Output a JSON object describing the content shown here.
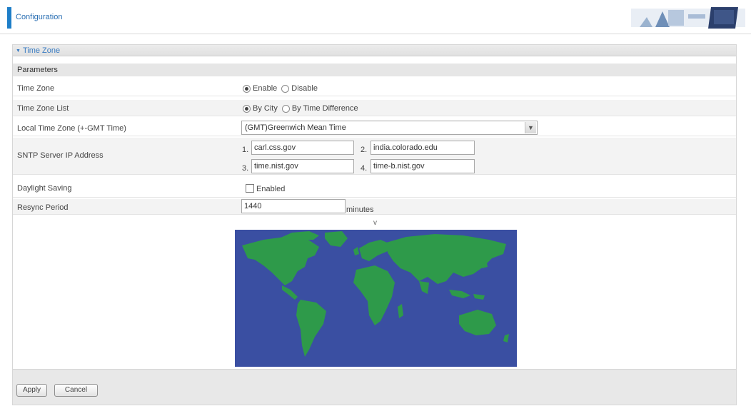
{
  "header": {
    "title": "Configuration"
  },
  "section": {
    "title": "Time Zone"
  },
  "params": {
    "title": "Parameters"
  },
  "time_zone": {
    "label": "Time Zone",
    "options": [
      "Enable",
      "Disable"
    ],
    "selected": "Enable"
  },
  "time_zone_list": {
    "label": "Time Zone List",
    "options": [
      "By City",
      "By Time Difference"
    ],
    "selected": "By City"
  },
  "local_time_zone": {
    "label": "Local Time Zone (+-GMT Time)",
    "value": "(GMT)Greenwich Mean Time"
  },
  "sntp": {
    "label": "SNTP Server IP Address",
    "servers": [
      {
        "num": "1.",
        "value": "carl.css.gov"
      },
      {
        "num": "2.",
        "value": "india.colorado.edu"
      },
      {
        "num": "3.",
        "value": "time.nist.gov"
      },
      {
        "num": "4.",
        "value": "time-b.nist.gov"
      }
    ]
  },
  "daylight": {
    "label": "Daylight Saving",
    "option": "Enabled",
    "checked": false
  },
  "resync": {
    "label": "Resync Period",
    "value": "1440",
    "unit": "minutes"
  },
  "map": {
    "marker": "v",
    "ocean_color": "#3a4fa2",
    "land_color": "#2e9a4a"
  },
  "footer": {
    "apply": "Apply",
    "cancel": "Cancel"
  },
  "colors": {
    "accent": "#1e7ec8",
    "link": "#3a7cc2"
  }
}
